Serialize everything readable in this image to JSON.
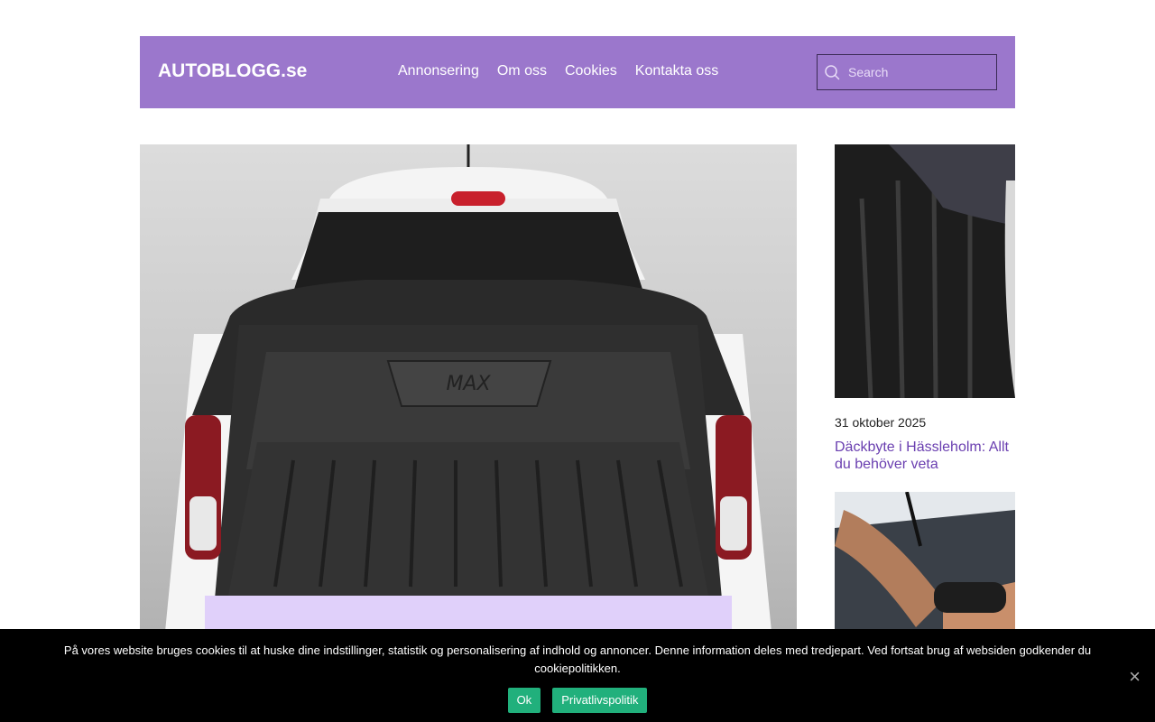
{
  "header": {
    "logo": "AUTOBLOGG.se",
    "nav": [
      "Annonsering",
      "Om oss",
      "Cookies",
      "Kontakta oss"
    ],
    "search_placeholder": "Search"
  },
  "sidebar": {
    "posts": [
      {
        "date": "31 oktober 2025",
        "title": "Däckbyte i Hässleholm: Allt du behöver veta"
      }
    ]
  },
  "cookie_notice": {
    "text": "På vores website bruges cookies til at huske dine indstillinger, statistik og personalisering af indhold og annoncer. Denne information deles med tredjepart. Ved fortsat brug af websiden godkender du cookiepolitikken.",
    "ok_label": "Ok",
    "policy_label": "Privatlivspolitik",
    "close_icon": "×"
  },
  "colors": {
    "header_bg": "#9b77cc",
    "link_purple": "#6a3fb0",
    "caption_bg": "#e0d0fa",
    "cookie_button": "#21b07c"
  }
}
